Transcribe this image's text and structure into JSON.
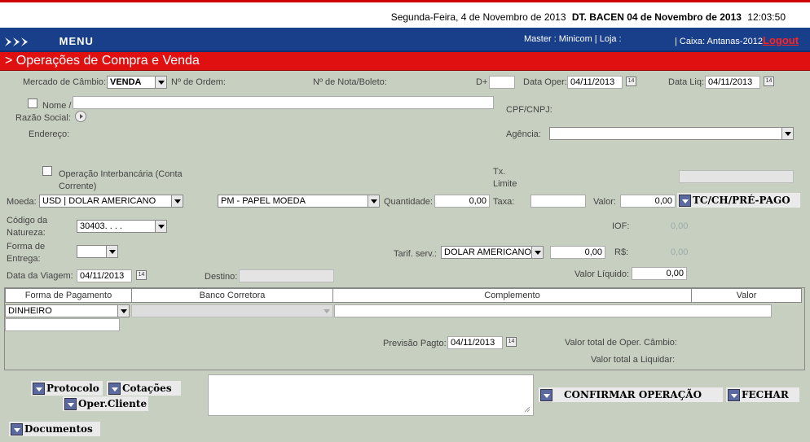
{
  "header": {
    "date_text": "Segunda-Feira, 4 de Novembro de 2013",
    "bacen_text": "DT. BACEN 04 de Novembro de 2013",
    "time_text": "12:03:50"
  },
  "nav": {
    "menu_label": "MENU",
    "master_text": "Master : Minicom | Loja :",
    "caixa_text": "| Caixa: Antanas-2012",
    "logout_label": "Logout"
  },
  "page_title": "> Operações de Compra e Venda",
  "form": {
    "mercado_label": "Mercado de Câmbio:",
    "mercado_value": "VENDA",
    "ordem_label": "Nº de Ordem:",
    "nota_label": "Nº de Nota/Boleto:",
    "dmais_label": "D+",
    "dmais_value": "",
    "data_oper_label": "Data Oper:",
    "data_oper_value": "04/11/2013",
    "data_liq_label": "Data Liq:",
    "data_liq_value": "04/11/2013",
    "nome_label": "Nome /",
    "razao_label": "Razão Social:",
    "nome_value": "",
    "cpf_label": "CPF/CNPJ:",
    "endereco_label": "Endereço:",
    "agencia_label": "Agência:",
    "agencia_value": "",
    "interbancaria_label": "Operação Interbancária (Conta Corrente)",
    "tx_limite_label": "Tx. Limite",
    "tx_limite_value": "",
    "moeda_label": "Moeda:",
    "moeda_value": "USD | DOLAR AMERICANO",
    "papel_value": "PM - PAPEL MOEDA",
    "quantidade_label": "Quantidade:",
    "quantidade_value": "0,00",
    "taxa_label": "Taxa:",
    "taxa_value": "",
    "valor_label": "Valor:",
    "valor_value": "0,00",
    "tc_label": "TC/CH/PRÉ-PAGO",
    "natureza_label": "Código da Natureza:",
    "natureza_value": "30403. . . .",
    "iof_label": "IOF:",
    "iof_value": "0,00",
    "entrega_label": "Forma de Entrega:",
    "entrega_value": "",
    "tarif_label": "Tarif. serv.:",
    "tarif_value": "DOLAR AMERICANO",
    "tarif_amount": "0,00",
    "rs_label": "R$:",
    "rs_value": "0,00",
    "viagem_label": "Data da Viagem:",
    "viagem_value": "04/11/2013",
    "destino_label": "Destino:",
    "destino_value": "",
    "valor_liquido_label": "Valor Líquido:",
    "valor_liquido_value": "0,00"
  },
  "payment": {
    "headers": [
      "Forma de Pagamento",
      "Banco Corretora",
      "Complemento",
      "Valor"
    ],
    "forma_value": "DINHEIRO",
    "banco_value": "",
    "complemento_value": "",
    "valor_value": "",
    "previsao_label": "Previsão Pagto:",
    "previsao_value": "04/11/2013",
    "total_oper_label": "Valor total de Oper. Câmbio:",
    "total_liq_label": "Valor total a Liquidar:"
  },
  "actions": {
    "protocolo": "Protocolo",
    "cotacoes": "Cotações",
    "oper_cliente": "Oper.Cliente",
    "documentos": "Documentos",
    "confirmar": "CONFIRMAR OPERAÇÃO",
    "fechar": "FECHAR"
  },
  "calendar_icon_text": "14"
}
